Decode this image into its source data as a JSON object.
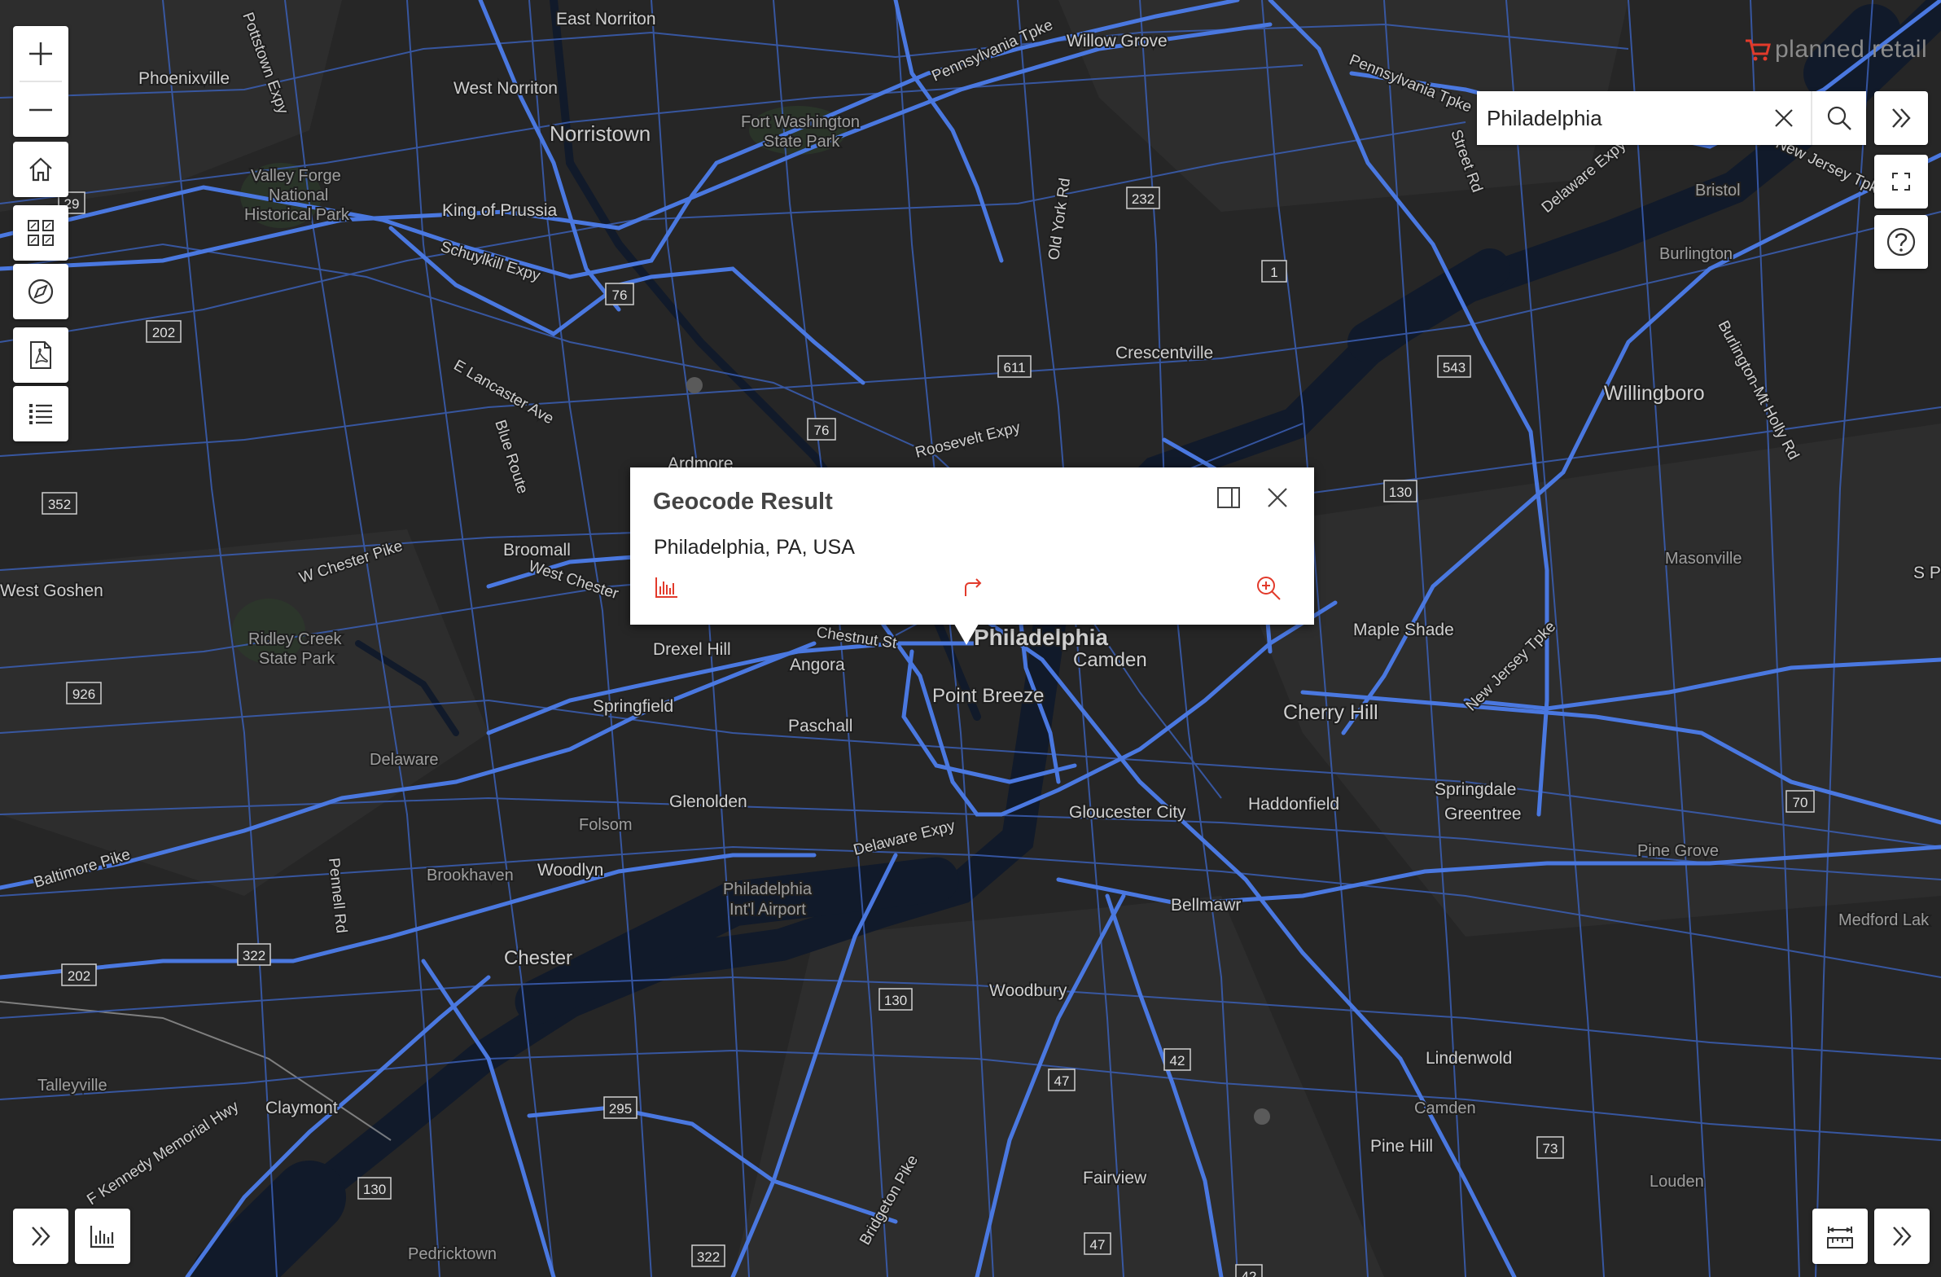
{
  "brand": {
    "name": "planned retail"
  },
  "search": {
    "value": "Philadelphia"
  },
  "popup": {
    "title": "Geocode Result",
    "address": "Philadelphia, PA, USA"
  },
  "map": {
    "labels": {
      "east_norriton": "East Norriton",
      "willow_grove": "Willow Grove",
      "phoenixville": "Phoenixville",
      "west_norriton": "West Norriton",
      "norristown": "Norristown",
      "fort_washington": "Fort Washington",
      "state_park": "State Park",
      "valley_forge_1": "Valley Forge",
      "valley_forge_2": "National",
      "valley_forge_3": "Historical Park",
      "king_of_prussia": "King of Prussia",
      "schuylkill": "Schuylkill Expy",
      "pottstown": "Pottstown Expy",
      "penn_tpke": "Pennsylvania Tpke",
      "penn_tpke_2": "Pennsylvania Tpke",
      "street_rd": "Street Rd",
      "old_york": "Old York Rd",
      "delaware_expy_n": "Delaware Expy",
      "bristol": "Bristol",
      "burlington": "Burlington",
      "nj_tpke_ne": "New Jersey Tpke",
      "crescentville": "Crescentville",
      "willingboro": "Willingboro",
      "burlington_pike": "Burlington-Mt Holly Rd",
      "e_lancaster": "E Lancaster Ave",
      "blue_route": "Blue Route",
      "roosevelt": "Roosevelt Expy",
      "ardmore": "Ardmore",
      "broomall": "Broomall",
      "w_chester_pike": "W Chester Pike",
      "west_chester": "West Chester",
      "west_goshen": "West Goshen",
      "masonville": "Masonville",
      "maple_shade": "Maple Shade",
      "philadelphia": "Philadelphia",
      "chestnut": "Chestnut St",
      "drexel_hill": "Drexel Hill",
      "angora": "Angora",
      "camden": "Camden",
      "point_breeze": "Point Breeze",
      "ridley_1": "Ridley Creek",
      "ridley_2": "State Park",
      "springfield": "Springfield",
      "paschall": "Paschall",
      "cherry_hill": "Cherry Hill",
      "nj_tpke_s": "New Jersey Tpke",
      "delaware": "Delaware",
      "springdale": "Springdale",
      "greentree": "Greentree",
      "glenolden": "Glenolden",
      "gloucester_city": "Gloucester City",
      "haddonfield": "Haddonfield",
      "folsom": "Folsom",
      "delaware_expy": "Delaware Expy",
      "pine_grove": "Pine Grove",
      "baltimore_pike": "Baltimore Pike",
      "pennell": "Pennell Rd",
      "brookhaven": "Brookhaven",
      "woodlyn": "Woodlyn",
      "phl_airport_1": "Philadelphia",
      "phl_airport_2": "Int'l Airport",
      "bellmawr": "Bellmawr",
      "medford": "Medford Lak",
      "chester": "Chester",
      "woodbury": "Woodbury",
      "lindenwold": "Lindenwold",
      "talleyville": "Talleyville",
      "claymont": "Claymont",
      "jfk_hwy": "F Kennedy Memorial Hwy",
      "camden_co": "Camden",
      "pine_hill": "Pine Hill",
      "fairview": "Fairview",
      "louden": "Louden",
      "bridgeton": "Bridgeton Pike",
      "pedricktown": "Pedricktown",
      "sp": "S P"
    },
    "shields": [
      "29",
      "76",
      "202",
      "232",
      "1",
      "611",
      "543",
      "76",
      "352",
      "130",
      "926",
      "70",
      "322",
      "202",
      "130",
      "42",
      "47",
      "295",
      "73",
      "130",
      "47",
      "322",
      "42"
    ]
  },
  "icons": {
    "zoom_in": "plus-icon",
    "zoom_out": "minus-icon",
    "home": "home-icon",
    "basemap": "grid-icon",
    "locate": "compass-icon",
    "print": "pdf-icon",
    "layers": "list-icon",
    "clear": "close-icon",
    "search": "search-icon",
    "expand": "double-chevron-right-icon",
    "fullscreen": "fullscreen-icon",
    "help": "help-icon",
    "chart": "bar-chart-icon",
    "measure": "ruler-icon",
    "dock": "dock-icon",
    "directions": "directions-icon",
    "zoom_to": "zoom-to-icon",
    "cart": "cart-icon"
  },
  "colors": {
    "map_background": "#262626",
    "road": "#3d6bd1",
    "water": "#111a2a",
    "accent": "#e23a2b"
  }
}
